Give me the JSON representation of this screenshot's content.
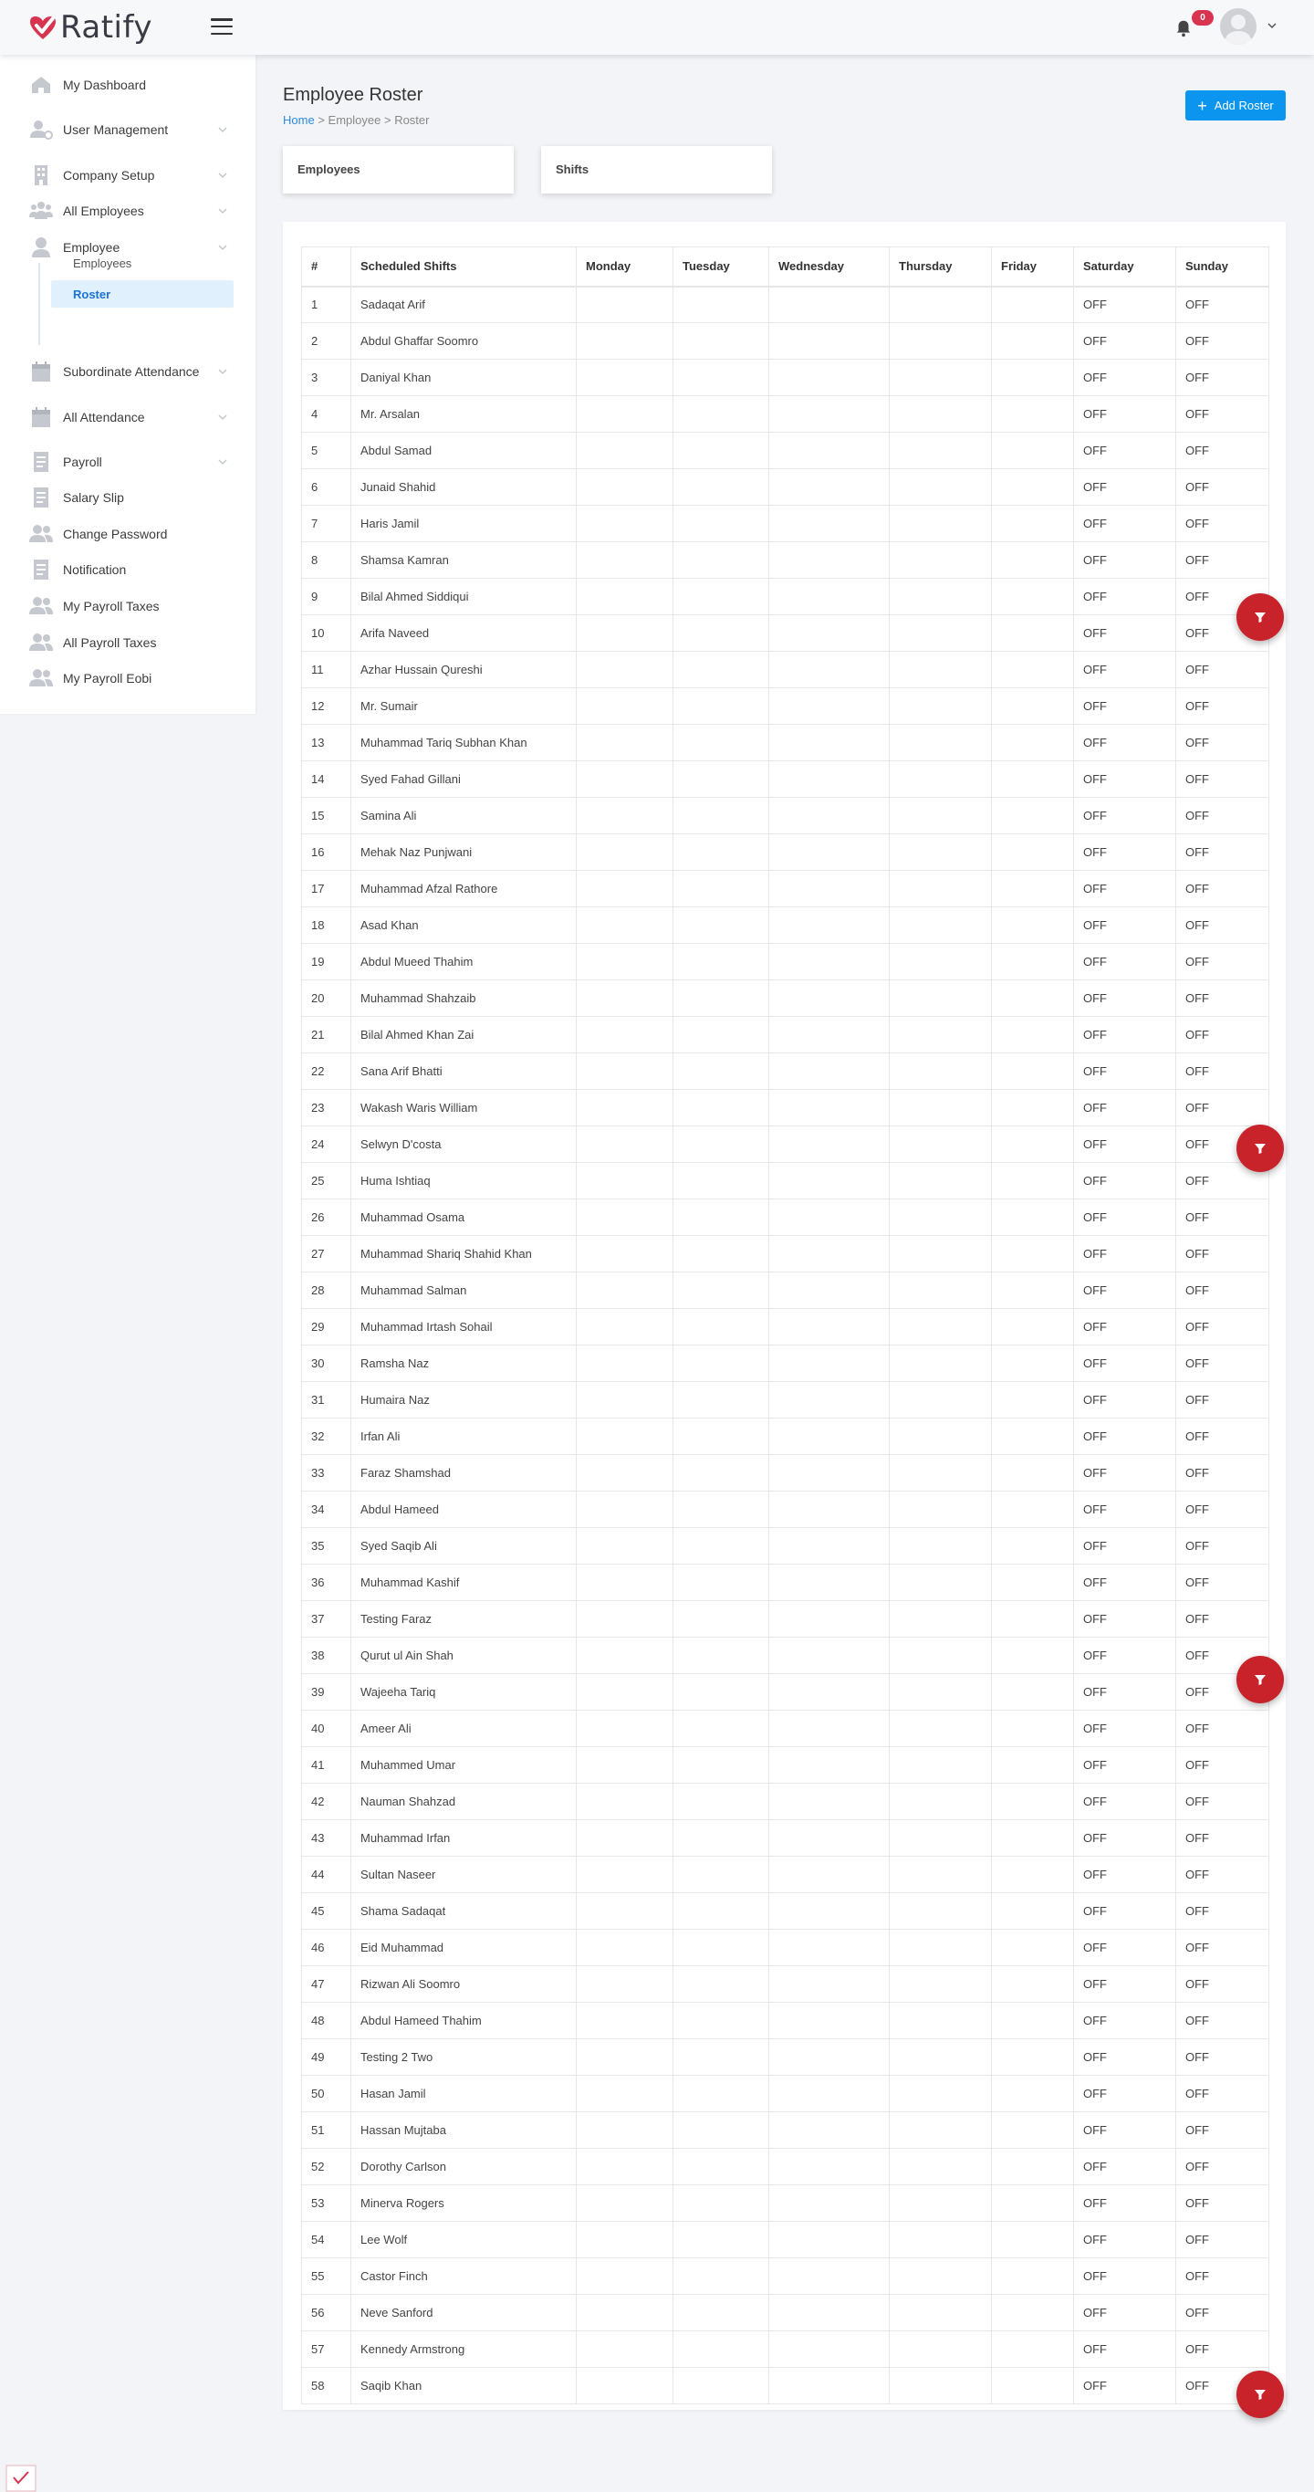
{
  "brand": {
    "name": "Ratify",
    "accent": "#d8344f"
  },
  "header": {
    "notification_count": "0"
  },
  "sidebar": {
    "items": [
      {
        "label": "My Dashboard",
        "icon": "home-icon",
        "chevron": false
      },
      {
        "label": "User Management",
        "icon": "user-settings-icon",
        "chevron": true
      },
      {
        "label": "Company Setup",
        "icon": "building-icon",
        "chevron": true
      },
      {
        "label": "All Employees",
        "icon": "users-group-icon",
        "chevron": true
      },
      {
        "label": "Employee",
        "icon": "user-icon",
        "chevron": true
      },
      {
        "label": "Subordinate Attendance",
        "icon": "calendar-icon",
        "chevron": true
      },
      {
        "label": "All Attendance",
        "icon": "calendar-icon",
        "chevron": true
      },
      {
        "label": "Payroll",
        "icon": "document-icon",
        "chevron": true
      },
      {
        "label": "Salary Slip",
        "icon": "document-icon",
        "chevron": false
      },
      {
        "label": "Change Password",
        "icon": "users-icon",
        "chevron": false
      },
      {
        "label": "Notification",
        "icon": "document-icon",
        "chevron": false
      },
      {
        "label": "My Payroll Taxes",
        "icon": "users-icon",
        "chevron": false
      },
      {
        "label": "All Payroll Taxes",
        "icon": "users-icon",
        "chevron": false
      },
      {
        "label": "My Payroll Eobi",
        "icon": "users-icon",
        "chevron": false
      }
    ],
    "employee_sub": [
      {
        "label": "Employees",
        "active": false
      },
      {
        "label": "Roster",
        "active": true
      }
    ]
  },
  "page": {
    "title": "Employee Roster",
    "breadcrumb": {
      "home": "Home",
      "sep": ">",
      "section": "Employee",
      "current": "Roster"
    },
    "add_button": "Add Roster",
    "tabs": [
      "Employees",
      "Shifts"
    ]
  },
  "table": {
    "headers": [
      "#",
      "Scheduled Shifts",
      "Monday",
      "Tuesday",
      "Wednesday",
      "Thursday",
      "Friday",
      "Saturday",
      "Sunday"
    ],
    "off_label": "OFF",
    "rows": [
      "Sadaqat Arif",
      "Abdul Ghaffar Soomro",
      "Daniyal Khan",
      "Mr. Arsalan",
      "Abdul Samad",
      "Junaid Shahid",
      "Haris Jamil",
      "Shamsa Kamran",
      "Bilal Ahmed Siddiqui",
      "Arifa Naveed",
      "Azhar Hussain Qureshi",
      "Mr. Sumair",
      "Muhammad Tariq Subhan Khan",
      "Syed Fahad Gillani",
      "Samina Ali",
      "Mehak Naz Punjwani",
      "Muhammad Afzal Rathore",
      "Asad Khan",
      "Abdul Mueed Thahim",
      "Muhammad Shahzaib",
      "Bilal Ahmed Khan Zai",
      "Sana Arif Bhatti",
      "Wakash Waris William",
      "Selwyn D'costa",
      "Huma Ishtiaq",
      "Muhammad Osama",
      "Muhammad Shariq Shahid Khan",
      "Muhammad Salman",
      "Muhammad Irtash Sohail",
      "Ramsha Naz",
      "Humaira Naz",
      "Irfan Ali",
      "Faraz Shamshad",
      "Abdul Hameed",
      "Syed Saqib Ali",
      "Muhammad Kashif",
      "Testing Faraz",
      "Qurut ul Ain Shah",
      "Wajeeha Tariq",
      "Ameer Ali",
      "Muhammed Umar",
      "Nauman Shahzad",
      "Muhammad Irfan",
      "Sultan Naseer",
      "Shama Sadaqat",
      "Eid Muhammad",
      "Rizwan Ali Soomro",
      "Abdul Hameed Thahim",
      "Testing 2 Two",
      "Hasan Jamil",
      "Hassan Mujtaba",
      "Dorothy Carlson",
      "Minerva Rogers",
      "Lee Wolf",
      "Castor Finch",
      "Neve Sanford",
      "Kennedy Armstrong",
      "Saqib Khan"
    ]
  },
  "filter_fab_icon": "filter-icon"
}
